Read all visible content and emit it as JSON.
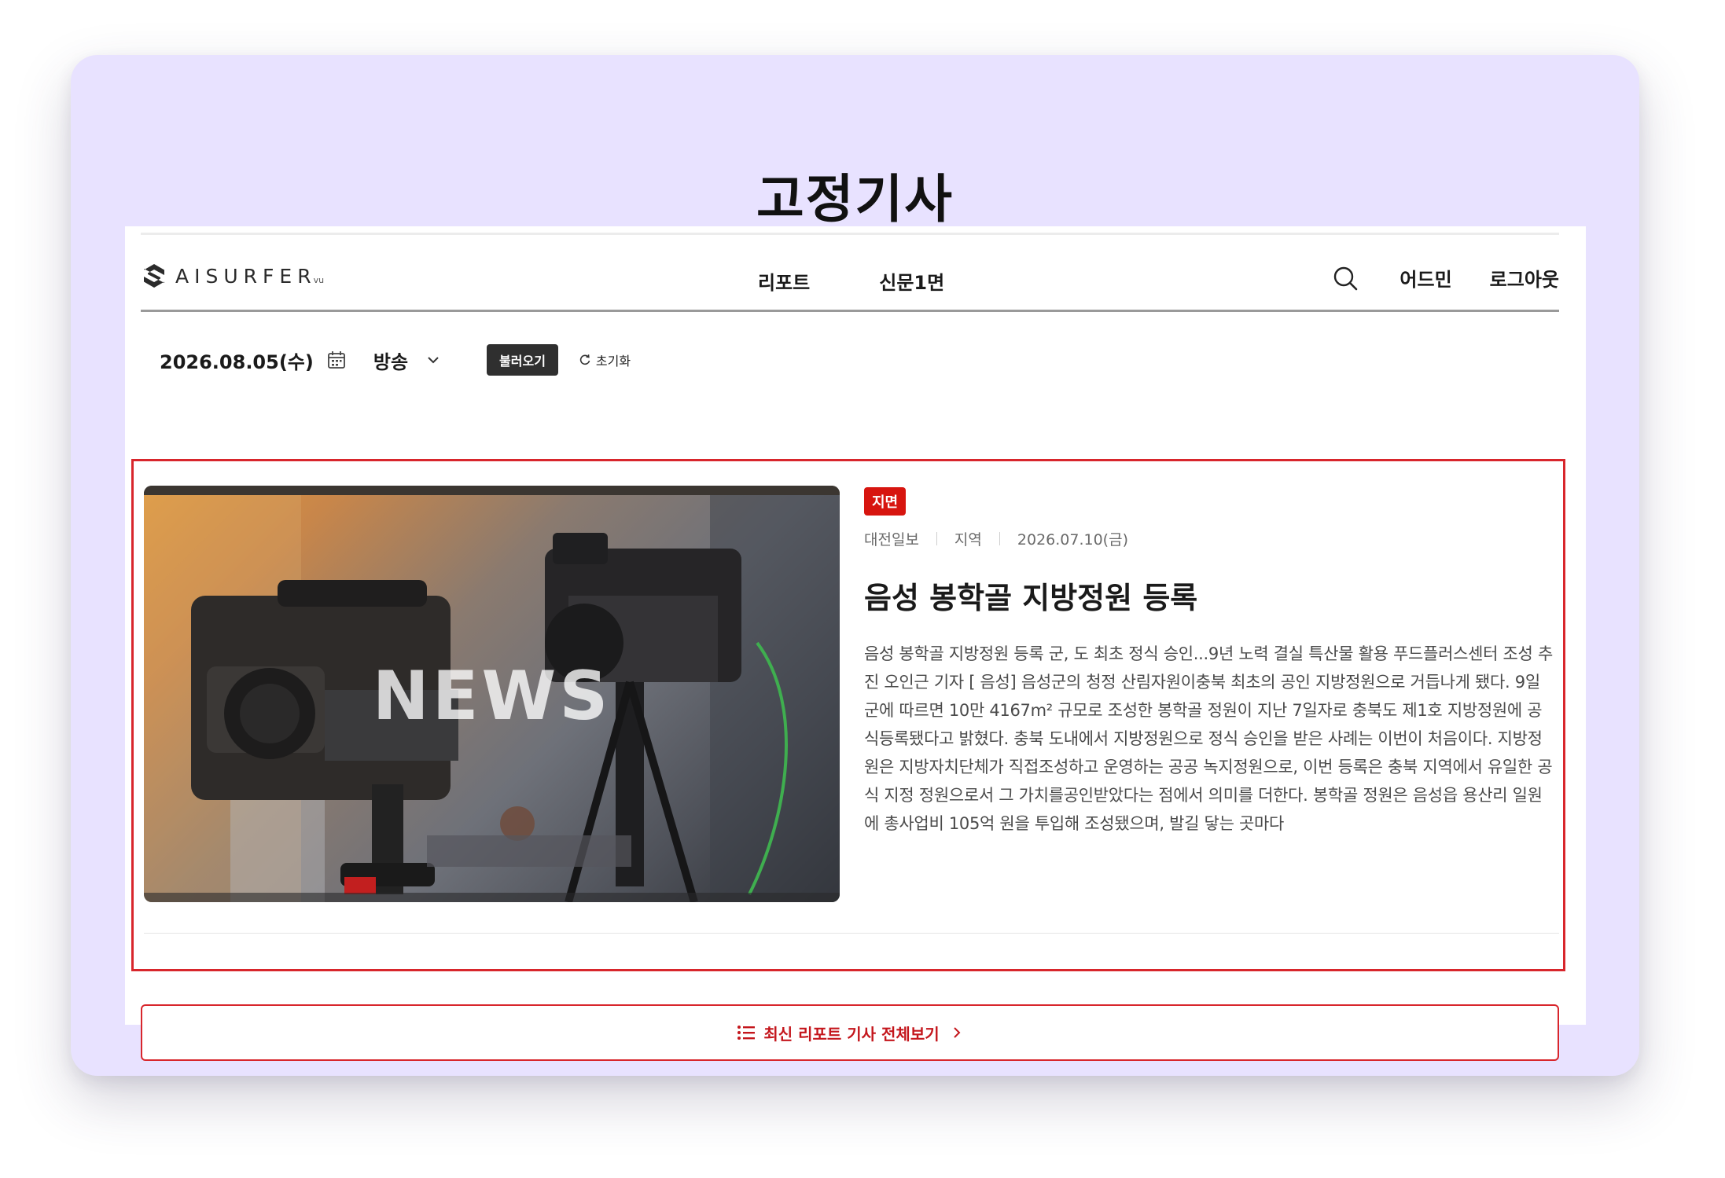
{
  "page": {
    "title": "고정기사"
  },
  "header": {
    "logo_text": "AISURFER",
    "logo_sub": "vu",
    "nav": [
      {
        "label": "리포트"
      },
      {
        "label": "신문1면"
      }
    ],
    "right": {
      "search_icon": "search-icon",
      "admin_label": "어드민",
      "logout_label": "로그아웃"
    }
  },
  "filter": {
    "date": "2026.08.05(수)",
    "calendar_icon": "calendar-icon",
    "source_select": "방송",
    "load_label": "불러오기",
    "reset_label": "초기화"
  },
  "article": {
    "image_text": "NEWS",
    "badge": "지면",
    "publisher": "대전일보",
    "region": "지역",
    "date": "2026.07.10(금)",
    "title": "음성 봉학골 지방정원 등록",
    "summary": "음성 봉학골 지방정원 등록 군, 도 최초 정식 승인...9년 노력 결실 특산물 활용 푸드플러스센터 조성 추진 오인근 기자 [ 음성] 음성군의 청정 산림자원이충북 최초의 공인 지방정원으로 거듭나게 됐다. 9일 군에 따르면 10만 4167m² 규모로 조성한 봉학골 정원이 지난 7일자로 충북도 제1호 지방정원에 공식등록됐다고 밝혔다. 충북 도내에서 지방정원으로 정식 승인을 받은 사례는 이번이 처음이다. 지방정원은 지방자치단체가 직접조성하고 운영하는 공공 녹지정원으로, 이번 등록은 충북 지역에서 유일한 공식 지정 정원으로서 그 가치를공인받았다는 점에서 의미를 더한다. 봉학골 정원은 음성읍 용산리 일원에 총사업비 105억 원을 투입해 조성됐으며, 발길 닿는 곳마다"
  },
  "more": {
    "label": "최신 리포트 기사 전체보기",
    "icon": "list-icon"
  },
  "colors": {
    "card_bg": "#e8e2ff",
    "accent_red": "#d7150f",
    "highlight_border": "#d8262c"
  }
}
